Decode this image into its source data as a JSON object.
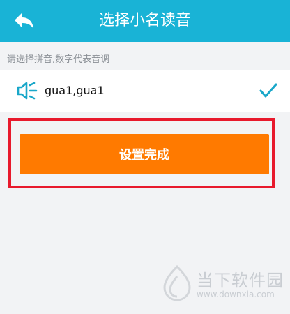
{
  "header": {
    "title": "选择小名读音",
    "back_icon": "back-arrow-icon",
    "bg_color": "#19b3d6"
  },
  "hint": "请选择拼音,数字代表音调",
  "options": [
    {
      "icon": "speaker-icon",
      "text": "gua1,gua1",
      "selected": true,
      "check_icon": "check-icon"
    }
  ],
  "done_button": {
    "label": "设置完成",
    "color": "#ff7a00"
  },
  "highlight_color": "#e8192c",
  "watermark": {
    "name": "当下软件园",
    "url": "www.downxia.com"
  }
}
